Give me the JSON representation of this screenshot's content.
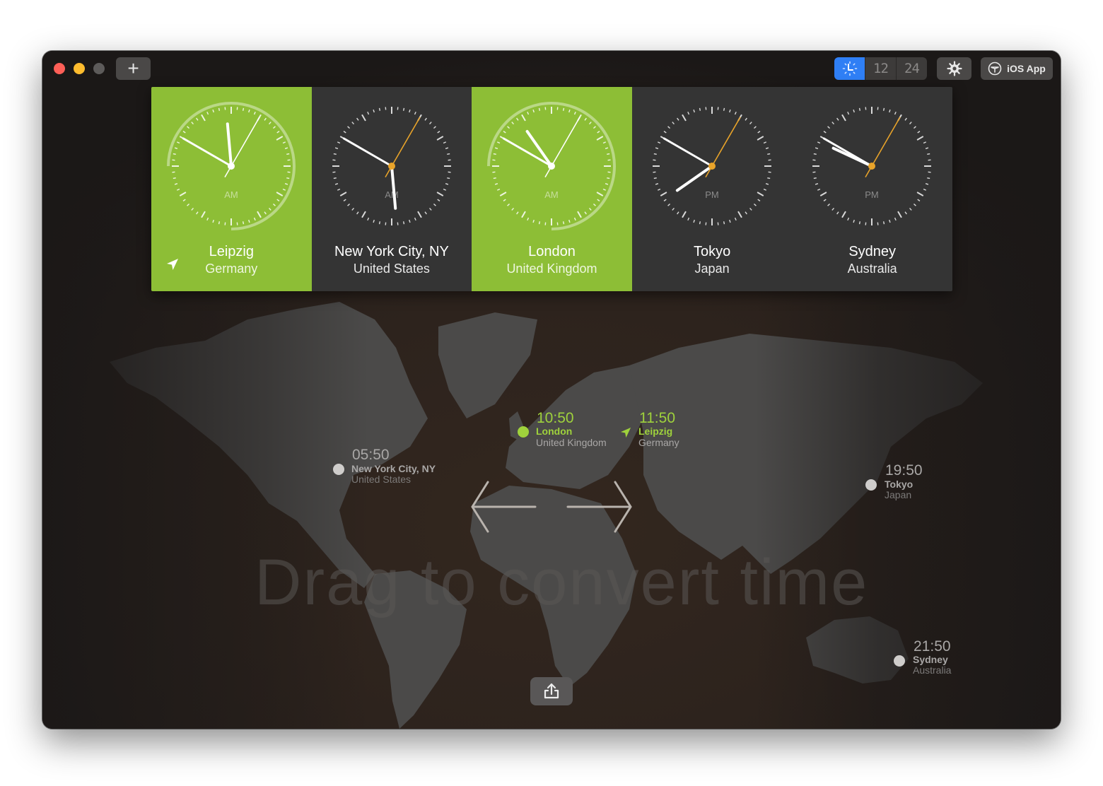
{
  "window": {
    "title_buttons": {
      "close": "close",
      "minimize": "minimize",
      "zoom": "zoom"
    },
    "add_button": "+"
  },
  "toolbar": {
    "mode_segments": [
      {
        "id": "analog",
        "icon": "clock-icon",
        "active": true
      },
      {
        "id": "12h",
        "label": "12",
        "active": false
      },
      {
        "id": "24h",
        "label": "24",
        "active": false
      }
    ],
    "settings_icon": "gear-icon",
    "ios_app_label": "iOS App",
    "accent": "#2f7ff5"
  },
  "colors": {
    "home_card": "#8dbe36",
    "card_bg": "#343434",
    "second_hand": "#e9a42a",
    "marker_green": "#9fd23c",
    "map_land": "#4a4948",
    "map_ocean": "#2e241e"
  },
  "clocks": [
    {
      "city": "Leipzig",
      "country": "Germany",
      "period": "AM",
      "hour": 11,
      "minute": 50,
      "second": 5,
      "highlight": true,
      "current_location": true
    },
    {
      "city": "New York City, NY",
      "country": "United States",
      "period": "AM",
      "hour": 5,
      "minute": 50,
      "second": 5,
      "highlight": false,
      "current_location": false
    },
    {
      "city": "London",
      "country": "United Kingdom",
      "period": "AM",
      "hour": 10,
      "minute": 50,
      "second": 5,
      "highlight": true,
      "current_location": false
    },
    {
      "city": "Tokyo",
      "country": "Japan",
      "period": "PM",
      "hour": 19,
      "minute": 50,
      "second": 5,
      "highlight": false,
      "current_location": false
    },
    {
      "city": "Sydney",
      "country": "Australia",
      "period": "PM",
      "hour": 21,
      "minute": 50,
      "second": 5,
      "highlight": false,
      "current_location": false
    }
  ],
  "map": {
    "watermark": "Drag to convert time",
    "markers": [
      {
        "time": "10:50",
        "city": "London",
        "country": "United Kingdom",
        "highlight": true
      },
      {
        "time": "11:50",
        "city": "Leipzig",
        "country": "Germany",
        "highlight": true,
        "current_location": true
      },
      {
        "time": "05:50",
        "city": "New York City, NY",
        "country": "United States",
        "highlight": false
      },
      {
        "time": "19:50",
        "city": "Tokyo",
        "country": "Japan",
        "highlight": false
      },
      {
        "time": "21:50",
        "city": "Sydney",
        "country": "Australia",
        "highlight": false
      }
    ],
    "share_icon": "share-icon"
  }
}
